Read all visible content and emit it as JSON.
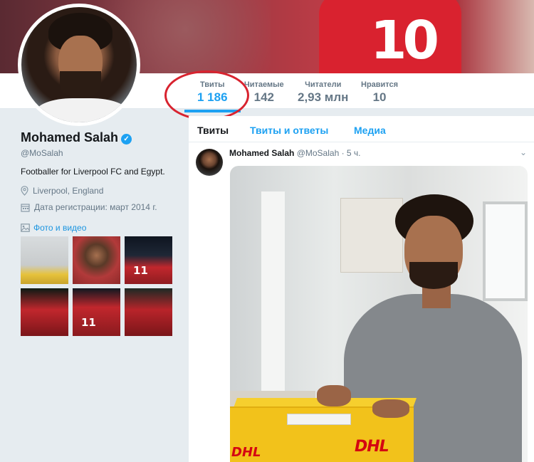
{
  "profile": {
    "name": "Mohamed Salah",
    "handle": "@MoSalah",
    "bio": "Footballer for Liverpool FC and Egypt.",
    "location": "Liverpool, England",
    "joined": "Дата регистрации: март 2014 г.",
    "media_link": "Фото и видео"
  },
  "stats": [
    {
      "label": "Твиты",
      "value": "1 186",
      "active": true
    },
    {
      "label": "Читаемые",
      "value": "142",
      "active": false
    },
    {
      "label": "Читатели",
      "value": "2,93 млн",
      "active": false
    },
    {
      "label": "Нравится",
      "value": "10",
      "active": false
    }
  ],
  "media_thumbs": [
    {
      "num": ""
    },
    {
      "num": ""
    },
    {
      "num": "11"
    },
    {
      "num": ""
    },
    {
      "num": "11"
    },
    {
      "num": ""
    }
  ],
  "timeline": {
    "tabs": [
      "Твиты",
      "Твиты и ответы",
      "Медиа"
    ],
    "tweet": {
      "name": "Mohamed Salah",
      "handle": "@MoSalah",
      "time": "· 5 ч."
    },
    "photo_brand": "DHL"
  },
  "banner": {
    "jersey_number": "10"
  },
  "colors": {
    "accent": "#1da1f2",
    "highlight_circle": "#d8232f"
  }
}
